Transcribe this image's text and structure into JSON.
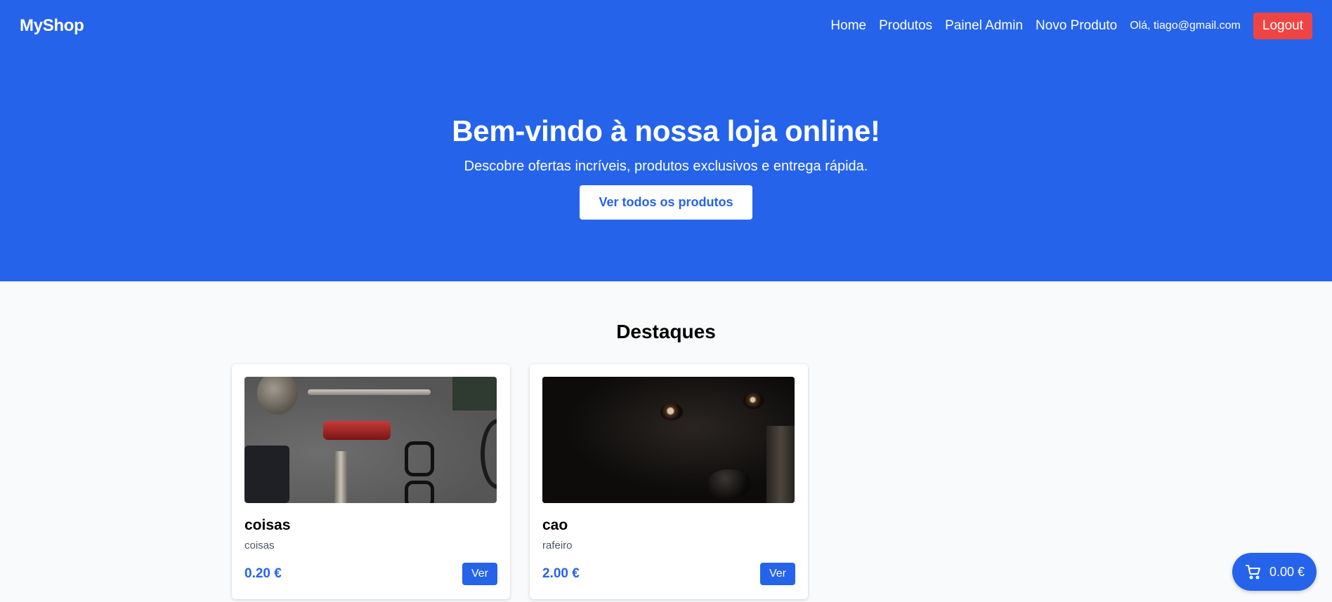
{
  "navbar": {
    "brand": "MyShop",
    "links": [
      "Home",
      "Produtos",
      "Painel Admin",
      "Novo Produto"
    ],
    "user_greeting": "Olá, tiago@gmail.com",
    "logout_label": "Logout"
  },
  "hero": {
    "title": "Bem-vindo à nossa loja online!",
    "subtitle": "Descobre ofertas incríveis, produtos exclusivos e entrega rápida.",
    "cta_label": "Ver todos os produtos"
  },
  "featured": {
    "heading": "Destaques",
    "products": [
      {
        "name": "coisas",
        "description": "coisas",
        "price": "0.20 €",
        "button_label": "Ver",
        "image_icon": "flat-lay-items-photo"
      },
      {
        "name": "cao",
        "description": "rafeiro",
        "price": "2.00 €",
        "button_label": "Ver",
        "image_icon": "black-dog-photo"
      }
    ]
  },
  "cart": {
    "total": "0.00 €",
    "icon": "cart-icon"
  },
  "colors": {
    "primary": "#2563eb",
    "danger": "#ef4444",
    "background": "#f8fafc"
  }
}
